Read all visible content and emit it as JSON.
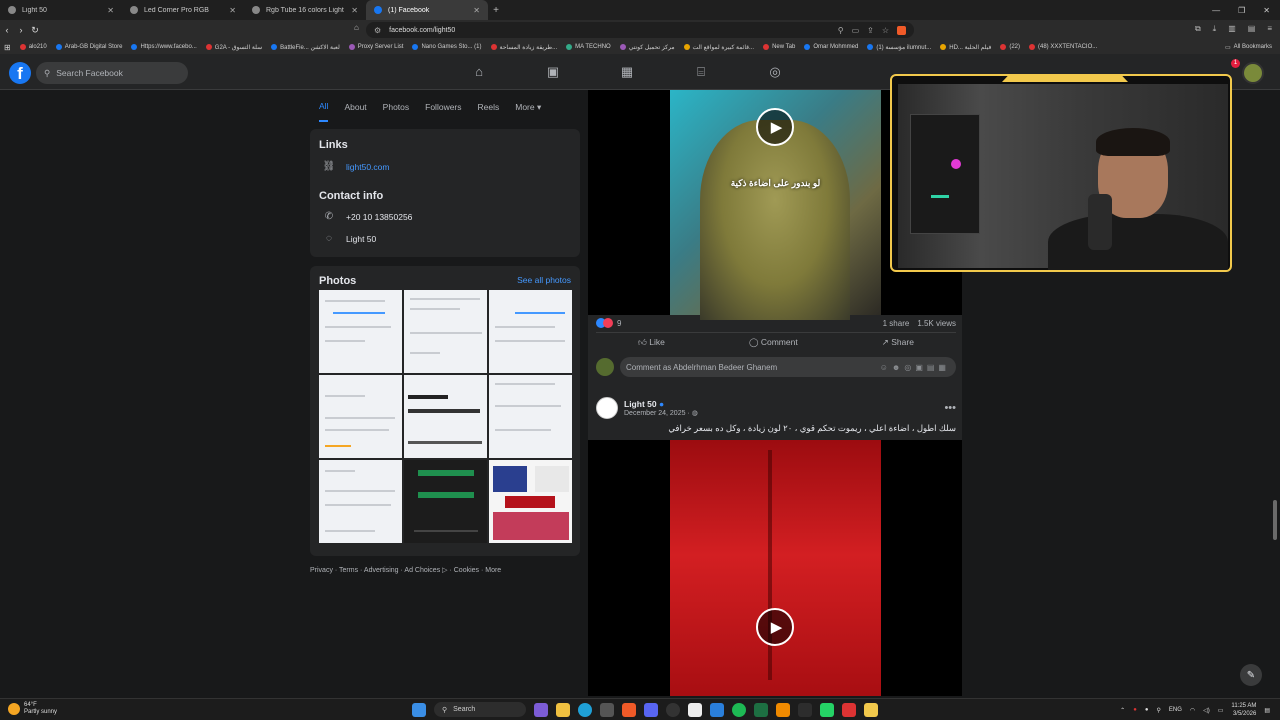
{
  "browser": {
    "tabs": [
      {
        "label": "Light 50"
      },
      {
        "label": "Led Corner Pro RGB"
      },
      {
        "label": "Rgb Tube 16 colors Light"
      },
      {
        "label": "(1) Facebook"
      }
    ],
    "url": "facebook.com/light50",
    "bookmarks": [
      "alo210",
      "Arab-GB Digital Store",
      "Https://www.facebo...",
      "G2A - سلة التسوق",
      "BattleFie... لعبة الاكشن",
      "Proxy Server List",
      "Nano Games Sto... (1)",
      "طريقة زيادة المساحة...",
      "MA TECHNO",
      "مركز تحميل كونتي",
      "قائمة كبيرة لمواقع الت...",
      "New Tab",
      "Omar Mohmmed",
      "(1) مؤسسة ilumnut...",
      "HD... فيلم الحلبة",
      "(22)",
      "(48) XXXTENTACIO..."
    ],
    "all_bookmarks": "All Bookmarks"
  },
  "fb": {
    "search_placeholder": "Search Facebook",
    "notif_count": "1"
  },
  "profile_tabs": [
    "All",
    "About",
    "Photos",
    "Followers",
    "Reels",
    "More"
  ],
  "links": {
    "heading": "Links",
    "website": "light50.com"
  },
  "contact": {
    "heading": "Contact info",
    "phone": "+20 10 13850256",
    "messenger": "Light 50"
  },
  "photos": {
    "heading": "Photos",
    "see_all": "See all photos"
  },
  "footer": "Privacy · Terms · Advertising · Ad Choices ▷ · Cookies · More",
  "post1": {
    "caption": "لو بندور على اضاءة ذكية",
    "reactions": "9",
    "shares": "1 share",
    "views": "1.5K views",
    "like": "Like",
    "comment": "Comment",
    "share": "Share",
    "comment_placeholder": "Comment as Abdelrhman Bedeer Ghanem"
  },
  "post2": {
    "author": "Light 50",
    "date": "December 24, 2025 · ",
    "text": "سلك اطول ، اضاءة اعلي ، ريموت تحكم قوي ، ٢٠ لون زيادة ، وكل ده بسعر خرافي"
  },
  "taskbar": {
    "temp": "64°F",
    "weather": "Partly sunny",
    "search": "Search",
    "lang": "ENG",
    "time": "11:25 AM",
    "date": "3/5/2026"
  },
  "colors": {
    "fb_blue": "#1877f2",
    "link_blue": "#4599ff",
    "webcam_frame": "#f2c94c"
  }
}
